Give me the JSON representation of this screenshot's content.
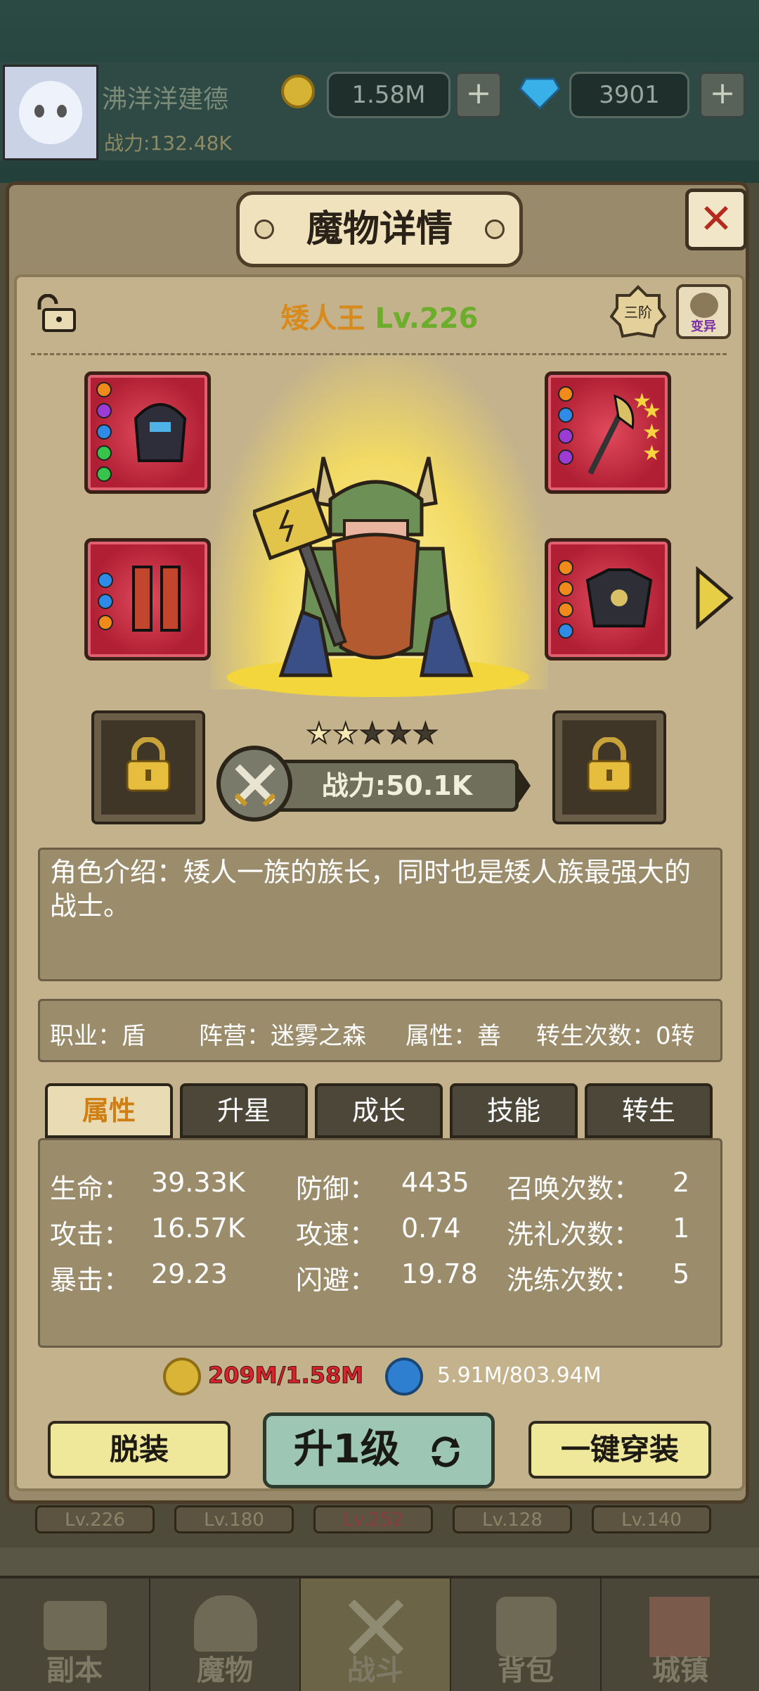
{
  "header": {
    "player_name": "沸洋洋建德",
    "power": "战力:132.48K",
    "gold": "1.58M",
    "gems": "3901",
    "plus": "+"
  },
  "dialog": {
    "title": "魔物详情",
    "close": "✕",
    "monster_name": "矮人王",
    "monster_level": "Lv.226",
    "rank": "三阶",
    "mutate": "变异",
    "power": "战力:50.1K",
    "stars_total": 5,
    "stars_filled": 2,
    "description": "角色介绍：矮人一族的族长，同时也是矮人族最强大的战士。"
  },
  "info": {
    "job": "职业：盾",
    "camp": "阵营：迷雾之森",
    "attr": "属性：善",
    "rebirth": "转生次数：0转"
  },
  "tabs": [
    "属性",
    "升星",
    "成长",
    "技能",
    "转生"
  ],
  "active_tab": 0,
  "stats": [
    {
      "label": "生命：",
      "value": "39.33K"
    },
    {
      "label": "防御：",
      "value": "4435"
    },
    {
      "label": "召唤次数：",
      "value": "2"
    },
    {
      "label": "攻击：",
      "value": "16.57K"
    },
    {
      "label": "攻速：",
      "value": "0.74"
    },
    {
      "label": "洗礼次数：",
      "value": "1"
    },
    {
      "label": "暴击：",
      "value": "29.23"
    },
    {
      "label": "闪避：",
      "value": "19.78"
    },
    {
      "label": "洗练次数：",
      "value": "5"
    }
  ],
  "resources": {
    "gold": "209M/1.58M",
    "essence": "5.91M/803.94M"
  },
  "buttons": {
    "unequip": "脱装",
    "level_up": "升1级",
    "equip_all": "一键穿装"
  },
  "below_levels": [
    "Lv.226",
    "Lv.180",
    "Lv.252",
    "Lv.128",
    "Lv.140"
  ],
  "nav": [
    "副本",
    "魔物",
    "战斗",
    "背包",
    "城镇"
  ],
  "nav_selected": 2,
  "colors": {
    "panel": "#988a6b",
    "inner": "#c3b28c",
    "accent_orange": "#d98a1c",
    "level_green": "#6cae2b",
    "gold_red": "#d8242a"
  }
}
